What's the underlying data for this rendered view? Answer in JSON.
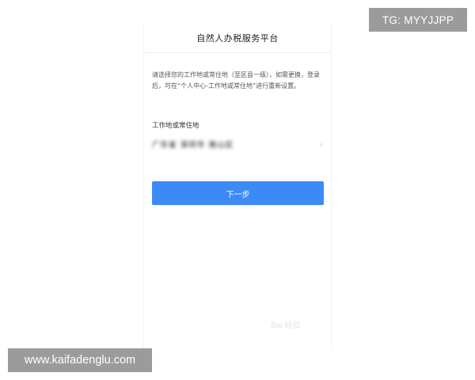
{
  "app": {
    "title": "自然人办税服务平台"
  },
  "instruction": {
    "text": "请选择您的工作地或常住地（至区县一级），如需更换，登录后，可在“个人中心-工作地或常住地”进行重新设置。"
  },
  "field": {
    "label": "工作地或常住地",
    "value": "广东省 深圳市 南山区",
    "chevron_icon": "chevron-right-icon"
  },
  "actions": {
    "next_label": "下一步"
  },
  "overlays": {
    "tg_text": "TG: MYYJJPP",
    "site_text": "www.kaifadenglu.com",
    "baidu_watermark": "Bai 经验"
  },
  "colors": {
    "primary": "#3d8af7",
    "badge_bg": "#9b9b9b"
  }
}
